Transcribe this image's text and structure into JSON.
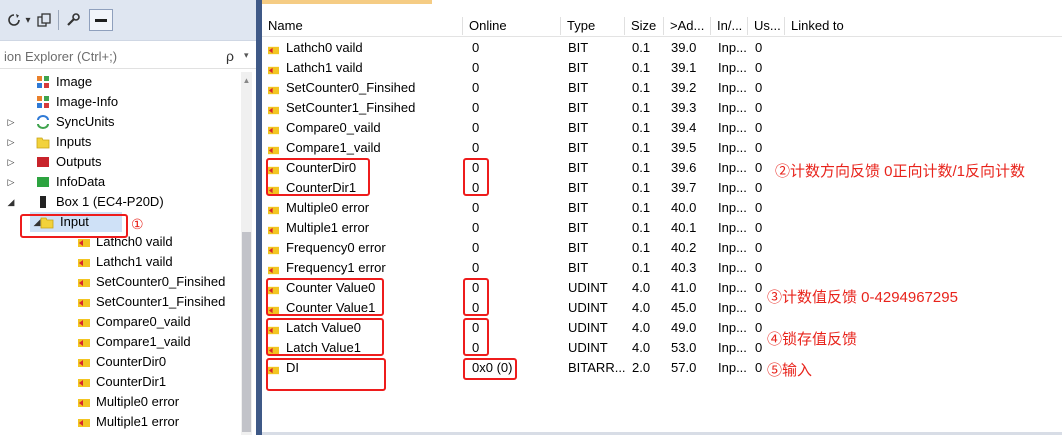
{
  "toolbar": {
    "icons": [
      "refresh-icon",
      "dropdown-caret-icon",
      "copy-window-icon",
      "wrench-icon",
      "collapse-all-icon"
    ]
  },
  "search": {
    "placeholder": "ion Explorer (Ctrl+;)",
    "icon_label": "ρ",
    "caret": "▾"
  },
  "tree": {
    "nodes": [
      {
        "label": "Image",
        "icon": "image-icon"
      },
      {
        "label": "Image-Info",
        "icon": "image-icon"
      },
      {
        "label": "SyncUnits",
        "icon": "sync-icon",
        "expander": "▷"
      },
      {
        "label": "Inputs",
        "icon": "folder-icon",
        "expander": "▷"
      },
      {
        "label": "Outputs",
        "icon": "outputs-icon",
        "expander": "▷"
      },
      {
        "label": "InfoData",
        "icon": "infodata-icon",
        "expander": "▷"
      },
      {
        "label": "Box 1 (EC4-P20D)",
        "icon": "box-icon",
        "expander": "◢"
      },
      {
        "label": "Input",
        "icon": "folder-icon",
        "expander": "◢"
      },
      {
        "label": "Lathch0 vaild"
      },
      {
        "label": "Lathch1 vaild"
      },
      {
        "label": "SetCounter0_Finsihed"
      },
      {
        "label": "SetCounter1_Finsihed"
      },
      {
        "label": "Compare0_vaild"
      },
      {
        "label": "Compare1_vaild"
      },
      {
        "label": "CounterDir0"
      },
      {
        "label": "CounterDir1"
      },
      {
        "label": "Multiple0 error"
      },
      {
        "label": "Multiple1 error"
      }
    ],
    "input_marker": "①"
  },
  "grid": {
    "headers": {
      "name": "Name",
      "online": "Online",
      "type": "Type",
      "size": "Size",
      "addr": ">Ad...",
      "inout": "In/...",
      "user": "Us...",
      "linked": "Linked to"
    },
    "rows": [
      {
        "name": "Lathch0 vaild",
        "online": "0",
        "type": "BIT",
        "size": "0.1",
        "addr": "39.0",
        "inout": "Inp...",
        "user": "0"
      },
      {
        "name": "Lathch1 vaild",
        "online": "0",
        "type": "BIT",
        "size": "0.1",
        "addr": "39.1",
        "inout": "Inp...",
        "user": "0"
      },
      {
        "name": "SetCounter0_Finsihed",
        "online": "0",
        "type": "BIT",
        "size": "0.1",
        "addr": "39.2",
        "inout": "Inp...",
        "user": "0"
      },
      {
        "name": "SetCounter1_Finsihed",
        "online": "0",
        "type": "BIT",
        "size": "0.1",
        "addr": "39.3",
        "inout": "Inp...",
        "user": "0"
      },
      {
        "name": "Compare0_vaild",
        "online": "0",
        "type": "BIT",
        "size": "0.1",
        "addr": "39.4",
        "inout": "Inp...",
        "user": "0"
      },
      {
        "name": "Compare1_vaild",
        "online": "0",
        "type": "BIT",
        "size": "0.1",
        "addr": "39.5",
        "inout": "Inp...",
        "user": "0"
      },
      {
        "name": "CounterDir0",
        "online": "0",
        "type": "BIT",
        "size": "0.1",
        "addr": "39.6",
        "inout": "Inp...",
        "user": "0"
      },
      {
        "name": "CounterDir1",
        "online": "0",
        "type": "BIT",
        "size": "0.1",
        "addr": "39.7",
        "inout": "Inp...",
        "user": "0"
      },
      {
        "name": "Multiple0 error",
        "online": "0",
        "type": "BIT",
        "size": "0.1",
        "addr": "40.0",
        "inout": "Inp...",
        "user": "0"
      },
      {
        "name": "Multiple1 error",
        "online": "0",
        "type": "BIT",
        "size": "0.1",
        "addr": "40.1",
        "inout": "Inp...",
        "user": "0"
      },
      {
        "name": "Frequency0 error",
        "online": "0",
        "type": "BIT",
        "size": "0.1",
        "addr": "40.2",
        "inout": "Inp...",
        "user": "0"
      },
      {
        "name": "Frequency1 error",
        "online": "0",
        "type": "BIT",
        "size": "0.1",
        "addr": "40.3",
        "inout": "Inp...",
        "user": "0"
      },
      {
        "name": "Counter Value0",
        "online": "0",
        "type": "UDINT",
        "size": "4.0",
        "addr": "41.0",
        "inout": "Inp...",
        "user": "0"
      },
      {
        "name": "Counter Value1",
        "online": "0",
        "type": "UDINT",
        "size": "4.0",
        "addr": "45.0",
        "inout": "Inp...",
        "user": "0"
      },
      {
        "name": "Latch Value0",
        "online": "0",
        "type": "UDINT",
        "size": "4.0",
        "addr": "49.0",
        "inout": "Inp...",
        "user": "0"
      },
      {
        "name": "Latch Value1",
        "online": "0",
        "type": "UDINT",
        "size": "4.0",
        "addr": "53.0",
        "inout": "Inp...",
        "user": "0"
      },
      {
        "name": "DI",
        "online": "0x0 (0)",
        "type": "BITARR...",
        "size": "2.0",
        "addr": "57.0",
        "inout": "Inp...",
        "user": "0"
      }
    ]
  },
  "annotations": {
    "counter_dir": "②计数方向反馈 0正向计数/1反向计数",
    "counter_value": "③计数值反馈 0-4294967295",
    "latch_value": "④锁存值反馈",
    "di": "⑤输入"
  },
  "colors": {
    "annotation_red": "#ee1c1c",
    "selection_blue": "#cfe1f7",
    "splitter": "#3f5987",
    "toolbar_bg": "#dfe6f1",
    "var_icon_yellow": "#f2c522",
    "var_icon_red": "#d8262c"
  }
}
